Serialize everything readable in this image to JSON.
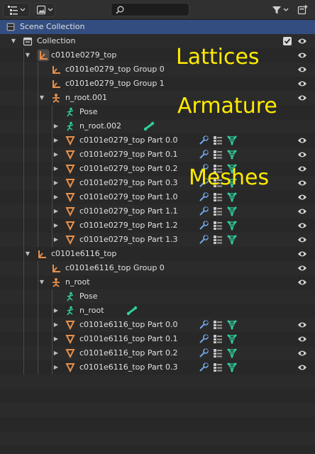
{
  "header": {
    "search_value": "",
    "display_mode_icon": "outliner-display-mode-icon",
    "filter_icon": "funnel-filter-icon",
    "new_collection_icon": "new-collection-icon"
  },
  "tree": {
    "scene_collection": "Scene Collection",
    "collection": "Collection",
    "obj1": "c0101e0279_top",
    "obj1_group0": "c0101e0279_top Group 0",
    "obj1_group1": "c0101e0279_top Group 1",
    "armature1": "n_root.001",
    "pose1": "Pose",
    "bone1": "n_root.002",
    "meshes1": [
      "c0101e0279_top Part 0.0",
      "c0101e0279_top Part 0.1",
      "c0101e0279_top Part 0.2",
      "c0101e0279_top Part 0.3",
      "c0101e0279_top Part 1.0",
      "c0101e0279_top Part 1.1",
      "c0101e0279_top Part 1.2",
      "c0101e0279_top Part 1.3"
    ],
    "obj2": "c0101e6116_top",
    "obj2_group0": "c0101e6116_top Group 0",
    "armature2": "n_root",
    "pose2": "Pose",
    "bone2": "n_root",
    "meshes2": [
      "c0101e6116_top Part 0.0",
      "c0101e6116_top Part 0.1",
      "c0101e6116_top Part 0.2",
      "c0101e6116_top Part 0.3"
    ]
  },
  "annotations": {
    "lattices": "Lattices",
    "armature": "Armature",
    "meshes": "Meshes"
  },
  "colors": {
    "selected_row": "#334d80",
    "object_orange": "#e8904a",
    "bone_green": "#2fd0a0",
    "modifier_blue": "#6fa8e6",
    "annotation_yellow": "#ffeb00"
  }
}
